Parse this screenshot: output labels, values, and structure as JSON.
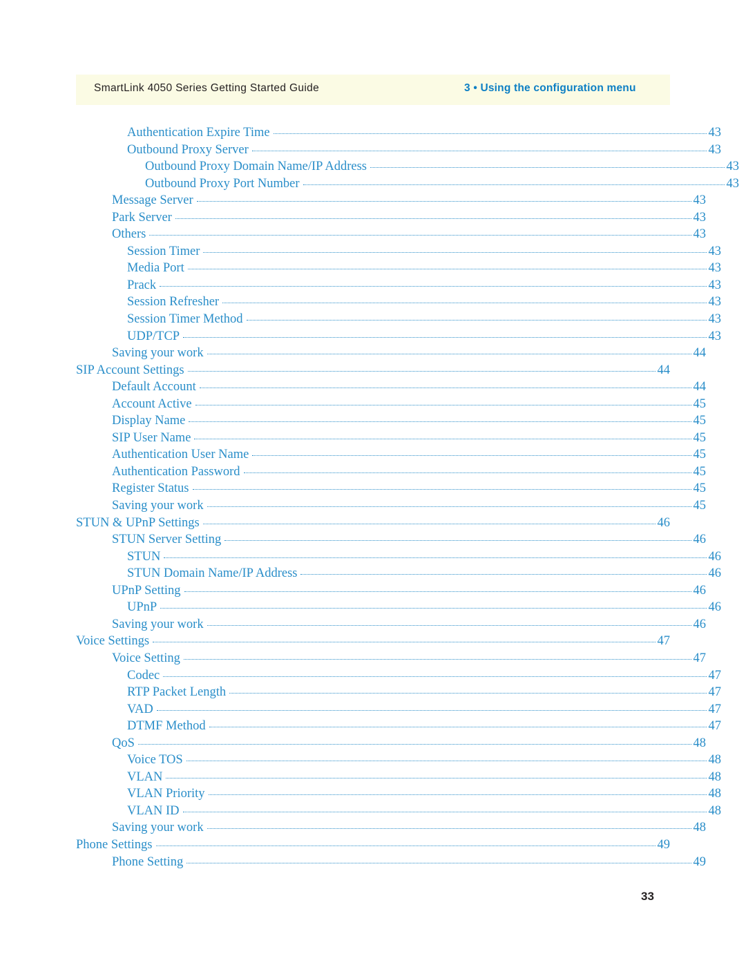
{
  "header": {
    "left_title": "SmartLink 4050 Series Getting Started Guide",
    "right_title": "3 • Using the configuration menu"
  },
  "toc": {
    "entries": [
      {
        "label": "Authentication Expire Time",
        "page": "43",
        "level": 2
      },
      {
        "label": "Outbound Proxy Server",
        "page": "43",
        "level": 2
      },
      {
        "label": "Outbound Proxy Domain Name/IP Address",
        "page": "43",
        "level": 3
      },
      {
        "label": "Outbound Proxy Port Number",
        "page": "43",
        "level": 3
      },
      {
        "label": "Message Server",
        "page": "43",
        "level": 1
      },
      {
        "label": "Park Server",
        "page": "43",
        "level": 1
      },
      {
        "label": "Others",
        "page": "43",
        "level": 1
      },
      {
        "label": "Session Timer",
        "page": "43",
        "level": 2
      },
      {
        "label": "Media Port",
        "page": "43",
        "level": 2
      },
      {
        "label": "Prack",
        "page": "43",
        "level": 2
      },
      {
        "label": "Session Refresher",
        "page": "43",
        "level": 2
      },
      {
        "label": "Session Timer Method",
        "page": "43",
        "level": 2
      },
      {
        "label": "UDP/TCP",
        "page": "43",
        "level": 2
      },
      {
        "label": "Saving your work",
        "page": "44",
        "level": 1
      },
      {
        "label": "SIP Account Settings",
        "page": "44",
        "level": 0
      },
      {
        "label": "Default Account",
        "page": "44",
        "level": 1
      },
      {
        "label": "Account Active",
        "page": "45",
        "level": 1
      },
      {
        "label": "Display Name",
        "page": "45",
        "level": 1
      },
      {
        "label": "SIP User Name",
        "page": "45",
        "level": 1
      },
      {
        "label": "Authentication User Name",
        "page": "45",
        "level": 1
      },
      {
        "label": "Authentication Password",
        "page": "45",
        "level": 1
      },
      {
        "label": "Register Status",
        "page": "45",
        "level": 1
      },
      {
        "label": "Saving your work",
        "page": "45",
        "level": 1
      },
      {
        "label": "STUN & UPnP Settings",
        "page": "46",
        "level": 0
      },
      {
        "label": "STUN Server Setting",
        "page": "46",
        "level": 1
      },
      {
        "label": "STUN",
        "page": "46",
        "level": 2
      },
      {
        "label": "STUN Domain Name/IP Address",
        "page": "46",
        "level": 2
      },
      {
        "label": "UPnP Setting",
        "page": "46",
        "level": 1
      },
      {
        "label": "UPnP",
        "page": "46",
        "level": 2
      },
      {
        "label": "Saving your work",
        "page": "46",
        "level": 1
      },
      {
        "label": "Voice Settings",
        "page": "47",
        "level": 0
      },
      {
        "label": "Voice Setting",
        "page": "47",
        "level": 1
      },
      {
        "label": "Codec",
        "page": "47",
        "level": 2
      },
      {
        "label": "RTP Packet Length",
        "page": "47",
        "level": 2
      },
      {
        "label": "VAD",
        "page": "47",
        "level": 2
      },
      {
        "label": "DTMF Method",
        "page": "47",
        "level": 2
      },
      {
        "label": "QoS",
        "page": "48",
        "level": 1
      },
      {
        "label": "Voice TOS",
        "page": "48",
        "level": 2
      },
      {
        "label": "VLAN",
        "page": "48",
        "level": 2
      },
      {
        "label": "VLAN Priority",
        "page": "48",
        "level": 2
      },
      {
        "label": "VLAN ID",
        "page": "48",
        "level": 2
      },
      {
        "label": "Saving your work",
        "page": "48",
        "level": 1
      },
      {
        "label": "Phone Settings",
        "page": "49",
        "level": 0
      },
      {
        "label": "Phone Setting",
        "page": "49",
        "level": 1
      }
    ]
  },
  "footer": {
    "page_number": "33"
  },
  "colors": {
    "link_blue": "#2a8ec9",
    "header_accent": "#0d7fc4",
    "band_yellow": "#fbfbe4",
    "text_black": "#231f20"
  }
}
